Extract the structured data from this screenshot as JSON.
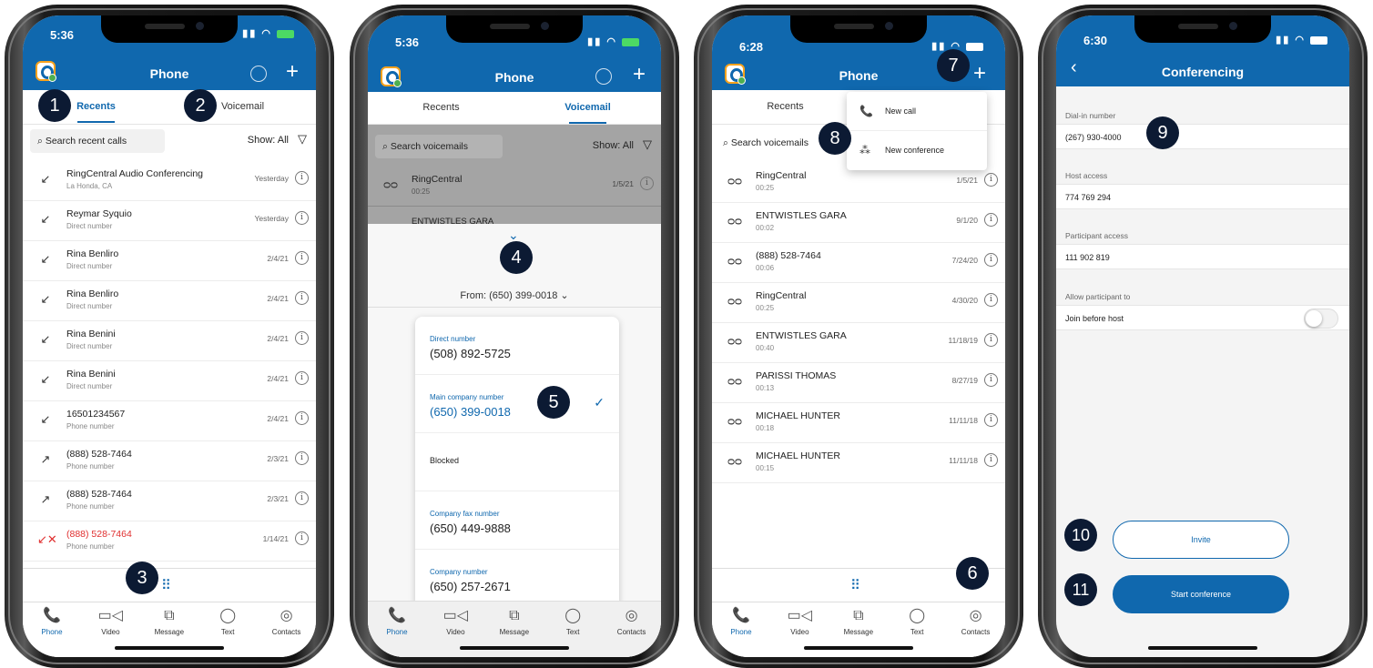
{
  "screens": [
    {
      "time": "5:36",
      "title": "Phone",
      "tabs": [
        "Recents",
        "Voicemail"
      ],
      "search_placeholder": "Search recent calls",
      "show_all": "Show: All",
      "rows": [
        {
          "name": "RingCentral Audio Conferencing",
          "sub": "La Honda, CA",
          "date": "Yesterday",
          "type": "incoming"
        },
        {
          "name": "Reymar Syquio",
          "sub": "Direct number",
          "date": "Yesterday",
          "type": "incoming"
        },
        {
          "name": "Rina Benliro",
          "sub": "Direct number",
          "date": "2/4/21",
          "type": "incoming"
        },
        {
          "name": "Rina Benliro",
          "sub": "Direct number",
          "date": "2/4/21",
          "type": "incoming"
        },
        {
          "name": "Rina Benini",
          "sub": "Direct number",
          "date": "2/4/21",
          "type": "incoming"
        },
        {
          "name": "Rina Benini",
          "sub": "Direct number",
          "date": "2/4/21",
          "type": "incoming"
        },
        {
          "name": "16501234567",
          "sub": "Phone number",
          "date": "2/4/21",
          "type": "incoming"
        },
        {
          "name": "(888) 528-7464",
          "sub": "Phone number",
          "date": "2/3/21",
          "type": "outgoing"
        },
        {
          "name": "(888) 528-7464",
          "sub": "Phone number",
          "date": "2/3/21",
          "type": "outgoing"
        },
        {
          "name": "(888) 528-7464",
          "sub": "Phone number",
          "date": "1/14/21",
          "type": "missed"
        }
      ]
    },
    {
      "time": "5:36",
      "title": "Phone",
      "tabs": [
        "Recents",
        "Voicemail"
      ],
      "search_placeholder": "Search voicemails",
      "show_all": "Show: All",
      "rows": [
        {
          "name": "RingCentral",
          "sub": "00:25",
          "date": "1/5/21"
        },
        {
          "name": "ENTWISTLES GARA",
          "sub": "",
          "date": ""
        }
      ],
      "from_label": "From: (650) 399-0018",
      "options": [
        {
          "label": "Direct number",
          "value": "(508) 892-5725"
        },
        {
          "label": "Main company number",
          "value": "(650) 399-0018",
          "selected": true
        },
        {
          "label": "",
          "value": "Blocked"
        },
        {
          "label": "Company fax number",
          "value": "(650) 449-9888"
        },
        {
          "label": "Company number",
          "value": "(650) 257-2671"
        }
      ]
    },
    {
      "time": "6:28",
      "title": "Phone",
      "tabs": [
        "Recents",
        "Voicemail"
      ],
      "search_placeholder": "Search voicemails",
      "menu": [
        "New call",
        "New conference"
      ],
      "rows": [
        {
          "name": "RingCentral",
          "sub": "00:25",
          "date": "1/5/21"
        },
        {
          "name": "ENTWISTLES GARA",
          "sub": "00:02",
          "date": "9/1/20"
        },
        {
          "name": "(888) 528-7464",
          "sub": "00:06",
          "date": "7/24/20"
        },
        {
          "name": "RingCentral",
          "sub": "00:25",
          "date": "4/30/20"
        },
        {
          "name": "ENTWISTLES GARA",
          "sub": "00:40",
          "date": "11/18/19"
        },
        {
          "name": "PARISSI THOMAS",
          "sub": "00:13",
          "date": "8/27/19"
        },
        {
          "name": "MICHAEL HUNTER",
          "sub": "00:18",
          "date": "11/11/18"
        },
        {
          "name": "MICHAEL HUNTER",
          "sub": "00:15",
          "date": "11/11/18"
        }
      ]
    },
    {
      "time": "6:30",
      "title": "Conferencing",
      "fields": [
        {
          "label": "Dial-in number",
          "value": "(267) 930-4000"
        },
        {
          "label": "Host access",
          "value": "774 769 294"
        },
        {
          "label": "Participant access",
          "value": "111 902 819"
        },
        {
          "label": "Allow participant to",
          "value": "Join before host"
        }
      ],
      "invite": "Invite",
      "start": "Start conference"
    }
  ],
  "nav": [
    "Phone",
    "Video",
    "Message",
    "Text",
    "Contacts"
  ],
  "badges": [
    "1",
    "2",
    "3",
    "4",
    "5",
    "6",
    "7",
    "8",
    "9",
    "10",
    "11"
  ],
  "colors": {
    "brand": "#1068ae",
    "badge": "#0c1a33",
    "missed": "#e02f2f"
  }
}
